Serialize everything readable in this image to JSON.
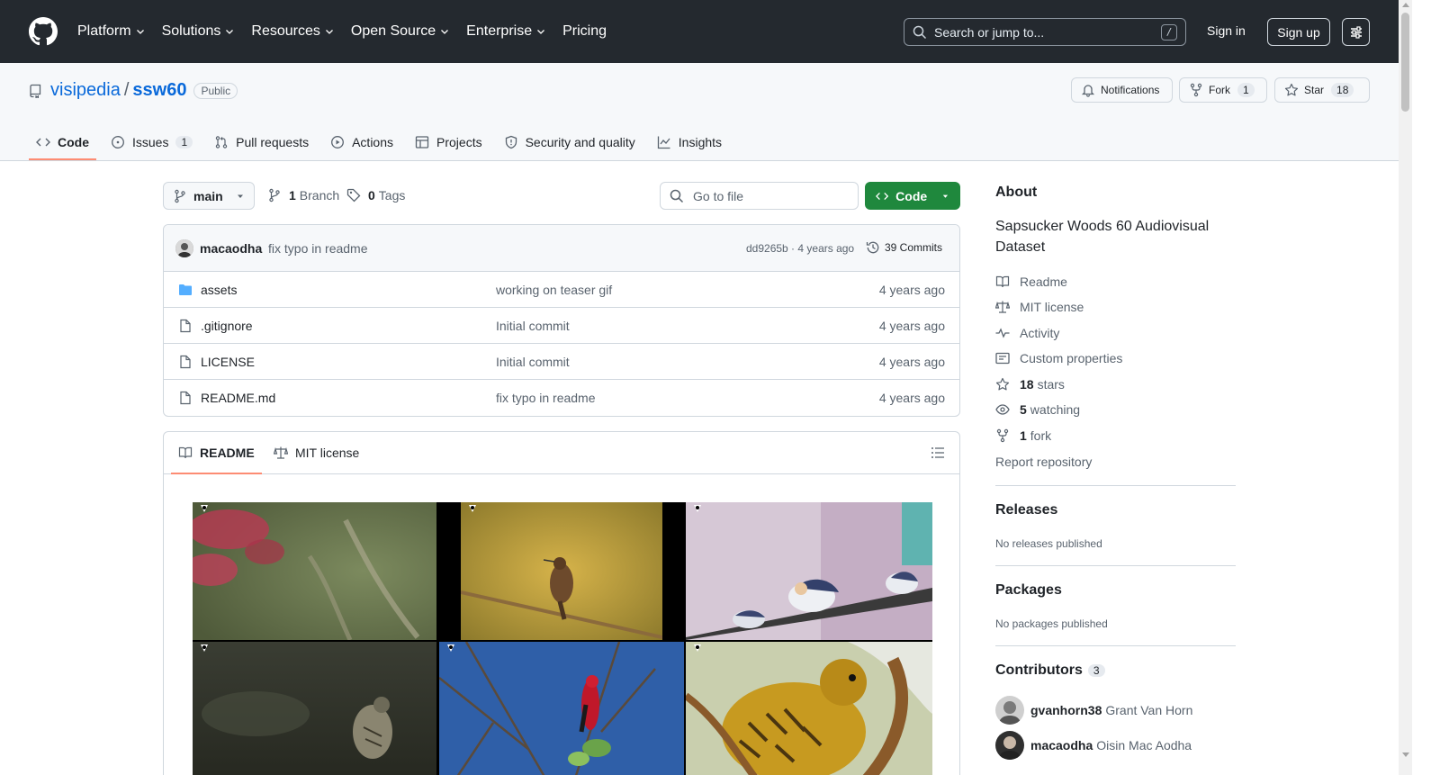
{
  "header": {
    "nav": [
      {
        "label": "Platform",
        "dropdown": true
      },
      {
        "label": "Solutions",
        "dropdown": true
      },
      {
        "label": "Resources",
        "dropdown": true
      },
      {
        "label": "Open Source",
        "dropdown": true
      },
      {
        "label": "Enterprise",
        "dropdown": true
      },
      {
        "label": "Pricing",
        "dropdown": false
      }
    ],
    "search_placeholder": "Search or jump to...",
    "search_shortcut": "/",
    "sign_in": "Sign in",
    "sign_up": "Sign up"
  },
  "repo": {
    "owner": "visipedia",
    "separator": "/",
    "name": "ssw60",
    "visibility": "Public",
    "notifications_label": "Notifications",
    "fork_label": "Fork",
    "fork_count": "1",
    "star_label": "Star",
    "star_count": "18"
  },
  "tabs": [
    {
      "label": "Code",
      "icon": "code-icon",
      "active": true,
      "count": ""
    },
    {
      "label": "Issues",
      "icon": "issue-icon",
      "active": false,
      "count": "1"
    },
    {
      "label": "Pull requests",
      "icon": "pull-request-icon",
      "active": false,
      "count": ""
    },
    {
      "label": "Actions",
      "icon": "play-icon",
      "active": false,
      "count": ""
    },
    {
      "label": "Projects",
      "icon": "table-icon",
      "active": false,
      "count": ""
    },
    {
      "label": "Security and quality",
      "icon": "shield-icon",
      "active": false,
      "count": ""
    },
    {
      "label": "Insights",
      "icon": "graph-icon",
      "active": false,
      "count": ""
    }
  ],
  "toolbar": {
    "branch": "main",
    "branch_count": "1",
    "branch_label": "Branch",
    "tag_count": "0",
    "tag_label": "Tags",
    "goto_placeholder": "Go to file",
    "code_label": "Code"
  },
  "commit": {
    "user": "macaodha",
    "message": "fix typo in readme",
    "sha_time": "dd9265b · 4 years ago",
    "commits": "39 Commits"
  },
  "files": [
    {
      "name": "assets",
      "type": "folder",
      "message": "working on teaser gif",
      "age": "4 years ago"
    },
    {
      "name": ".gitignore",
      "type": "file",
      "message": "Initial commit",
      "age": "4 years ago"
    },
    {
      "name": "LICENSE",
      "type": "file",
      "message": "Initial commit",
      "age": "4 years ago"
    },
    {
      "name": "README.md",
      "type": "file",
      "message": "fix typo in readme",
      "age": "4 years ago"
    }
  ],
  "readme": {
    "tab_readme": "README",
    "tab_license": "MIT license"
  },
  "sidebar": {
    "about_title": "About",
    "description": "Sapsucker Woods 60 Audiovisual Dataset",
    "links": [
      {
        "icon": "book-icon",
        "label": "Readme",
        "count": ""
      },
      {
        "icon": "law-icon",
        "label": "MIT license",
        "count": ""
      },
      {
        "icon": "pulse-icon",
        "label": "Activity",
        "count": ""
      },
      {
        "icon": "note-icon",
        "label": "Custom properties",
        "count": ""
      },
      {
        "icon": "star-icon",
        "label": "stars",
        "count": "18"
      },
      {
        "icon": "eye-icon",
        "label": "watching",
        "count": "5"
      },
      {
        "icon": "fork-icon",
        "label": "fork",
        "count": "1"
      }
    ],
    "report": "Report repository",
    "releases_title": "Releases",
    "releases_empty": "No releases published",
    "packages_title": "Packages",
    "packages_empty": "No packages published",
    "contributors_title": "Contributors",
    "contributors_count": "3",
    "contributors": [
      {
        "login": "gvanhorn38",
        "name": "Grant Van Horn"
      },
      {
        "login": "macaodha",
        "name": "Oisin Mac Aodha"
      }
    ]
  },
  "colors": {
    "header_bg": "#24292f",
    "link": "#0969da",
    "primary_button": "#1f883d",
    "active_tab_underline": "#fd8c73"
  }
}
